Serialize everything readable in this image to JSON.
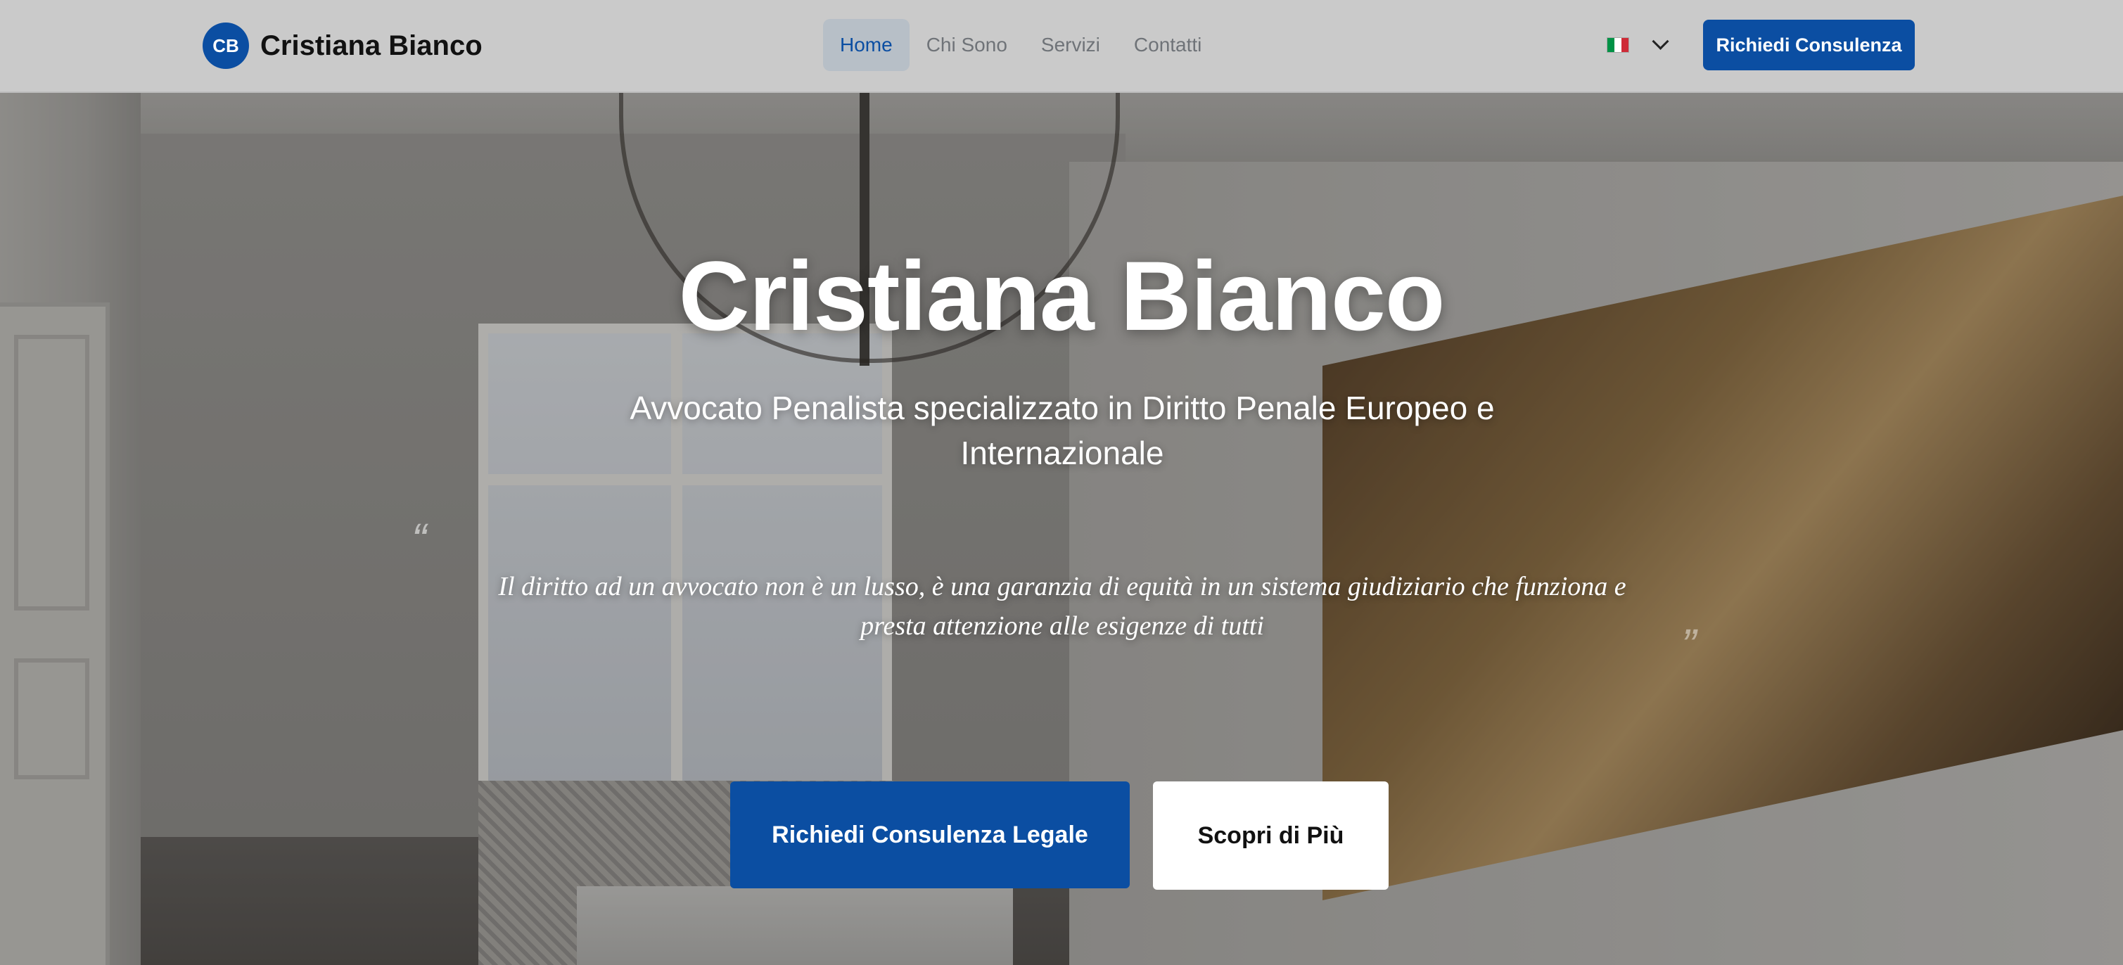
{
  "navbar": {
    "brand_initials": "CB",
    "brand_name": "Cristiana Bianco",
    "links": [
      {
        "label": "Home",
        "active": true
      },
      {
        "label": "Chi Sono",
        "active": false
      },
      {
        "label": "Servizi",
        "active": false
      },
      {
        "label": "Contatti",
        "active": false
      }
    ],
    "language_icon": "italy-flag-icon",
    "cta_label": "Richiedi Consulenza"
  },
  "hero": {
    "title": "Cristiana Bianco",
    "subtitle": "Avvocato Penalista specializzato in Diritto Penale Europeo e Internazionale",
    "quote_open": "“",
    "quote": "Il diritto ad un avvocato non è un lusso, è una garanzia di equità in un sistema giudiziario che funziona e presta attenzione alle esigenze di tutti",
    "quote_close": "”",
    "primary_button": "Richiedi Consulenza Legale",
    "secondary_button": "Scopri di Più"
  },
  "colors": {
    "accent": "#0b4ea2",
    "flag_green": "#009246",
    "flag_white": "#ffffff",
    "flag_red": "#ce2b37"
  }
}
